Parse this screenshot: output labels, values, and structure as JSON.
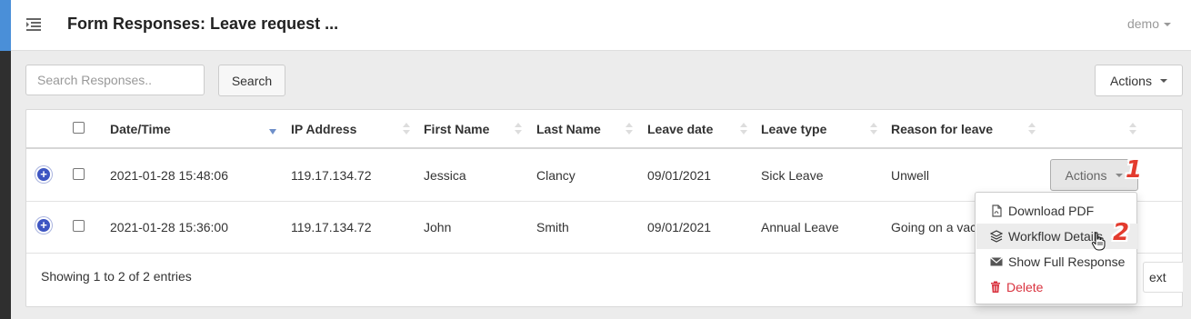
{
  "header": {
    "title": "Form Responses: Leave request ...",
    "user": "demo"
  },
  "toolbar": {
    "search_placeholder": "Search Responses..",
    "search_label": "Search",
    "actions_label": "Actions"
  },
  "table": {
    "columns": [
      "Date/Time",
      "IP Address",
      "First Name",
      "Last Name",
      "Leave date",
      "Leave type",
      "Reason for leave"
    ],
    "sorted_column": "Date/Time",
    "rows": [
      {
        "datetime": "2021-01-28 15:48:06",
        "ip": "119.17.134.72",
        "first_name": "Jessica",
        "last_name": "Clancy",
        "leave_date": "09/01/2021",
        "leave_type": "Sick Leave",
        "reason": "Unwell",
        "actions_label": "Actions"
      },
      {
        "datetime": "2021-01-28 15:36:00",
        "ip": "119.17.134.72",
        "first_name": "John",
        "last_name": "Smith",
        "leave_date": "09/01/2021",
        "leave_type": "Annual Leave",
        "reason": "Going on a vac"
      }
    ],
    "footer": "Showing 1 to 2 of 2 entries",
    "next_label": "ext"
  },
  "dropdown": {
    "items": [
      {
        "label": "Download PDF",
        "icon": "file-pdf-icon"
      },
      {
        "label": "Workflow Details",
        "icon": "layers-icon"
      },
      {
        "label": "Show Full Response",
        "icon": "envelope-icon"
      },
      {
        "label": "Delete",
        "icon": "trash-icon"
      }
    ]
  },
  "annotations": {
    "step1": "1",
    "step2": "2"
  },
  "colors": {
    "accent": "#4a8fd8",
    "expand": "#3d55c2",
    "danger": "#d9333f",
    "step": "#e33b2e"
  }
}
